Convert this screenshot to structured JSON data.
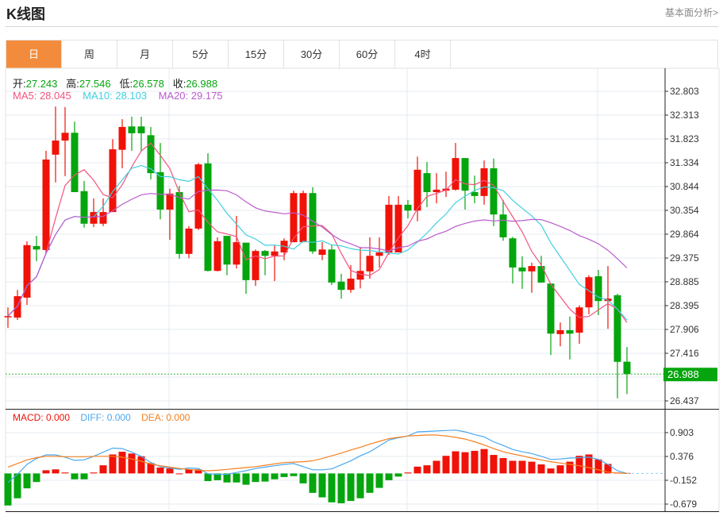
{
  "header": {
    "title": "K线图",
    "link": "基本面分析>"
  },
  "tabs": [
    "日",
    "周",
    "月",
    "5分",
    "15分",
    "30分",
    "60分",
    "4时"
  ],
  "active_tab": 0,
  "ohlc_info": {
    "open_label": "开:",
    "open": "27.243",
    "high_label": "高:",
    "high": "27.546",
    "low_label": "低:",
    "low": "26.578",
    "close_label": "收:",
    "close": "26.988"
  },
  "ma_info": {
    "ma5": "MA5: 28.045",
    "ma10": "MA10: 28.103",
    "ma20": "MA20: 29.175"
  },
  "macd_info": {
    "macd": "MACD: 0.000",
    "diff": "DIFF: 0.000",
    "dea": "DEA: 0.000"
  },
  "colors": {
    "up": "#f01208",
    "down": "#05a50e",
    "ma5": "#f2547e",
    "ma10": "#3fcfe0",
    "ma20": "#b95ccc",
    "diff": "#4aa8f0",
    "dea": "#f5801f",
    "accent": "#f28c3c"
  },
  "chart_data": [
    {
      "type": "candlestick",
      "title": "K线图",
      "y_ticks": [
        "32.803",
        "32.313",
        "31.823",
        "31.334",
        "30.844",
        "30.354",
        "29.864",
        "29.375",
        "28.885",
        "28.395",
        "27.906",
        "27.416",
        "26.437"
      ],
      "ylim": [
        26.437,
        32.803
      ],
      "last_price": "26.988",
      "candles": [
        [
          28.17,
          28.36,
          27.94,
          28.18
        ],
        [
          28.15,
          28.72,
          28.1,
          28.59
        ],
        [
          28.56,
          29.72,
          28.41,
          29.64
        ],
        [
          29.62,
          29.83,
          29.31,
          29.55
        ],
        [
          29.54,
          31.58,
          29.46,
          31.4
        ],
        [
          31.5,
          32.49,
          30.93,
          31.79
        ],
        [
          31.79,
          32.48,
          31.06,
          31.95
        ],
        [
          31.95,
          32.18,
          30.73,
          30.73
        ],
        [
          30.75,
          30.96,
          30.0,
          30.08
        ],
        [
          30.08,
          30.6,
          30.01,
          30.32
        ],
        [
          30.08,
          30.6,
          30.03,
          30.32
        ],
        [
          30.32,
          31.82,
          30.32,
          31.61
        ],
        [
          31.6,
          32.23,
          31.22,
          32.07
        ],
        [
          32.08,
          32.28,
          31.58,
          31.94
        ],
        [
          32.08,
          32.28,
          31.58,
          31.94
        ],
        [
          31.9,
          32.07,
          30.99,
          31.12
        ],
        [
          31.14,
          31.74,
          30.17,
          30.37
        ],
        [
          30.37,
          30.8,
          29.75,
          30.7
        ],
        [
          30.73,
          30.86,
          29.36,
          29.46
        ],
        [
          29.46,
          30.03,
          29.37,
          29.98
        ],
        [
          29.98,
          31.33,
          29.95,
          31.3
        ],
        [
          31.32,
          31.53,
          29.1,
          29.11
        ],
        [
          29.11,
          29.8,
          29.1,
          29.72
        ],
        [
          29.83,
          29.83,
          29.02,
          29.24
        ],
        [
          29.24,
          30.24,
          29.16,
          29.7
        ],
        [
          29.69,
          29.69,
          28.64,
          28.92
        ],
        [
          28.92,
          29.55,
          28.8,
          29.52
        ],
        [
          29.52,
          29.54,
          29.02,
          29.42
        ],
        [
          29.42,
          29.64,
          28.9,
          29.51
        ],
        [
          29.49,
          29.78,
          29.33,
          29.73
        ],
        [
          29.7,
          30.76,
          29.7,
          30.71
        ],
        [
          29.7,
          30.76,
          29.7,
          30.71
        ],
        [
          30.71,
          30.83,
          29.46,
          29.51
        ],
        [
          29.44,
          29.7,
          29.33,
          29.55
        ],
        [
          29.55,
          29.64,
          28.82,
          28.87
        ],
        [
          28.89,
          29.05,
          28.54,
          28.72
        ],
        [
          28.72,
          29.23,
          28.66,
          28.95
        ],
        [
          28.93,
          29.6,
          28.75,
          29.11
        ],
        [
          29.1,
          29.8,
          28.95,
          29.42
        ],
        [
          29.42,
          29.8,
          29.18,
          29.49
        ],
        [
          29.49,
          30.65,
          29.44,
          30.47
        ],
        [
          29.49,
          30.65,
          29.49,
          30.47
        ],
        [
          30.47,
          30.57,
          30.19,
          30.35
        ],
        [
          30.35,
          31.46,
          30.13,
          31.19
        ],
        [
          31.12,
          31.35,
          30.42,
          30.73
        ],
        [
          30.73,
          31.12,
          30.5,
          30.78
        ],
        [
          30.76,
          31.15,
          30.63,
          30.8
        ],
        [
          30.78,
          31.74,
          30.76,
          31.43
        ],
        [
          31.43,
          31.43,
          30.37,
          30.76
        ],
        [
          30.73,
          31.07,
          30.5,
          30.65
        ],
        [
          30.65,
          31.38,
          30.47,
          31.22
        ],
        [
          31.22,
          31.42,
          30.03,
          30.27
        ],
        [
          30.27,
          30.57,
          29.73,
          29.8
        ],
        [
          29.78,
          29.81,
          28.85,
          29.18
        ],
        [
          29.18,
          29.41,
          28.74,
          29.1
        ],
        [
          29.1,
          29.28,
          28.66,
          29.21
        ],
        [
          29.21,
          29.42,
          28.87,
          28.87
        ],
        [
          28.85,
          28.85,
          27.38,
          27.82
        ],
        [
          27.81,
          28.05,
          27.56,
          27.89
        ],
        [
          27.89,
          28.17,
          27.29,
          27.82
        ],
        [
          27.84,
          28.4,
          27.61,
          28.36
        ],
        [
          28.36,
          29.02,
          28.22,
          28.98
        ],
        [
          29.0,
          29.13,
          28.2,
          28.49
        ],
        [
          28.49,
          29.21,
          27.92,
          28.54
        ],
        [
          28.61,
          28.64,
          26.49,
          27.24
        ],
        [
          27.243,
          27.546,
          26.578,
          26.988
        ]
      ]
    },
    {
      "type": "bar",
      "title": "MACD",
      "y_ticks": [
        "0.903",
        "0.376",
        "-0.152",
        "-0.679"
      ],
      "ylim": [
        -0.83,
        1.06
      ],
      "macd": [
        -0.71,
        -0.55,
        -0.33,
        -0.19,
        0.07,
        0.09,
        0.02,
        -0.13,
        -0.13,
        0.02,
        0.18,
        0.42,
        0.48,
        0.44,
        0.38,
        0.23,
        0.13,
        0.11,
        0.0,
        0.09,
        0.09,
        -0.17,
        -0.15,
        -0.2,
        -0.2,
        -0.25,
        -0.19,
        -0.18,
        -0.13,
        -0.08,
        -0.06,
        -0.22,
        -0.43,
        -0.53,
        -0.64,
        -0.66,
        -0.61,
        -0.55,
        -0.43,
        -0.32,
        -0.15,
        -0.07,
        0.02,
        0.15,
        0.18,
        0.28,
        0.39,
        0.49,
        0.47,
        0.5,
        0.54,
        0.41,
        0.34,
        0.28,
        0.28,
        0.26,
        0.2,
        0.11,
        0.18,
        0.26,
        0.39,
        0.42,
        0.31,
        0.21,
        0.02,
        0.01
      ],
      "diff": [
        -0.2,
        -0.02,
        0.2,
        0.33,
        0.41,
        0.41,
        0.36,
        0.29,
        0.3,
        0.38,
        0.47,
        0.56,
        0.55,
        0.47,
        0.38,
        0.24,
        0.15,
        0.12,
        0.09,
        0.12,
        0.11,
        -0.01,
        -0.02,
        -0.02,
        0.02,
        0.06,
        0.11,
        0.14,
        0.17,
        0.2,
        0.22,
        0.15,
        0.08,
        0.08,
        0.1,
        0.19,
        0.28,
        0.39,
        0.48,
        0.61,
        0.74,
        0.79,
        0.83,
        0.92,
        0.93,
        0.94,
        0.95,
        0.96,
        0.92,
        0.86,
        0.81,
        0.7,
        0.62,
        0.53,
        0.48,
        0.44,
        0.38,
        0.31,
        0.32,
        0.34,
        0.35,
        0.36,
        0.31,
        0.2,
        0.06,
        0.0
      ],
      "dea": [
        0.14,
        0.22,
        0.3,
        0.35,
        0.38,
        0.38,
        0.37,
        0.37,
        0.37,
        0.38,
        0.38,
        0.38,
        0.36,
        0.32,
        0.27,
        0.21,
        0.17,
        0.14,
        0.11,
        0.09,
        0.07,
        0.06,
        0.07,
        0.09,
        0.11,
        0.13,
        0.15,
        0.18,
        0.21,
        0.24,
        0.25,
        0.26,
        0.28,
        0.33,
        0.39,
        0.45,
        0.52,
        0.58,
        0.65,
        0.71,
        0.77,
        0.8,
        0.83,
        0.84,
        0.85,
        0.85,
        0.83,
        0.8,
        0.76,
        0.7,
        0.63,
        0.55,
        0.48,
        0.43,
        0.39,
        0.34,
        0.3,
        0.26,
        0.23,
        0.2,
        0.17,
        0.13,
        0.08,
        0.03,
        0.01,
        0.0
      ]
    }
  ]
}
